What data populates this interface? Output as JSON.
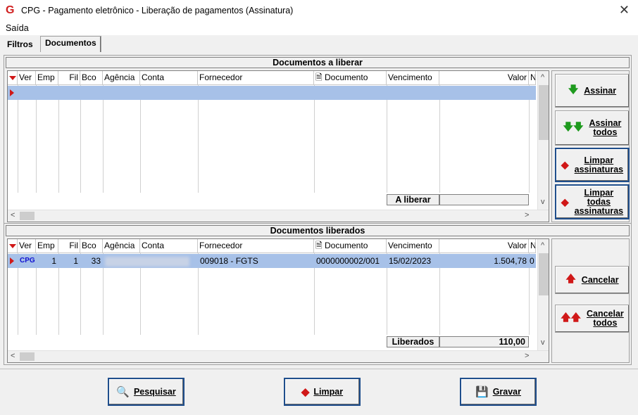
{
  "window": {
    "title": "CPG - Pagamento eletrônico - Liberação de pagamentos (Assinatura)",
    "logo_letter": "G",
    "close_glyph": "✕"
  },
  "menu": {
    "items": [
      "Saída"
    ]
  },
  "tabs": [
    {
      "label": "Filtros"
    },
    {
      "label": "Documentos"
    }
  ],
  "columns": {
    "ver": "Ver",
    "emp": "Emp",
    "fil": "Fil",
    "bco": "Bco",
    "agencia": "Agência",
    "conta": "Conta",
    "fornecedor": "Fornecedor",
    "documento": "Documento",
    "vencimento": "Vencimento",
    "valor": "Valor",
    "extra": "N"
  },
  "panel_top": {
    "title": "Documentos a liberar",
    "footer_label": "A liberar",
    "buttons": {
      "assinar": "Assinar",
      "assinar_todos_1": "Assinar",
      "assinar_todos_2": "todos",
      "limpar_ass_1": "Limpar",
      "limpar_ass_2": "assinaturas",
      "limpar_todas_1": "Limpar",
      "limpar_todas_2": "todas",
      "limpar_todas_3": "assinaturas"
    }
  },
  "panel_bottom": {
    "title": "Documentos liberados",
    "footer_label": "Liberados",
    "footer_value": "110,00",
    "row": {
      "ver": "CPG",
      "emp": "1",
      "fil": "1",
      "bco": "33",
      "fornecedor": "009018 - FGTS",
      "documento": "0000000002/001",
      "vencimento": "15/02/2023",
      "valor": "1.504,78",
      "extra": "0"
    },
    "buttons": {
      "cancelar": "Cancelar",
      "cancelar_todos_1": "Cancelar",
      "cancelar_todos_2": "todos"
    }
  },
  "bottom_buttons": {
    "pesquisar": "Pesquisar",
    "limpar": "Limpar",
    "gravar": "Gravar"
  },
  "scroll_glyphs": {
    "left": "<",
    "right": ">",
    "up": "^",
    "down": "v"
  }
}
